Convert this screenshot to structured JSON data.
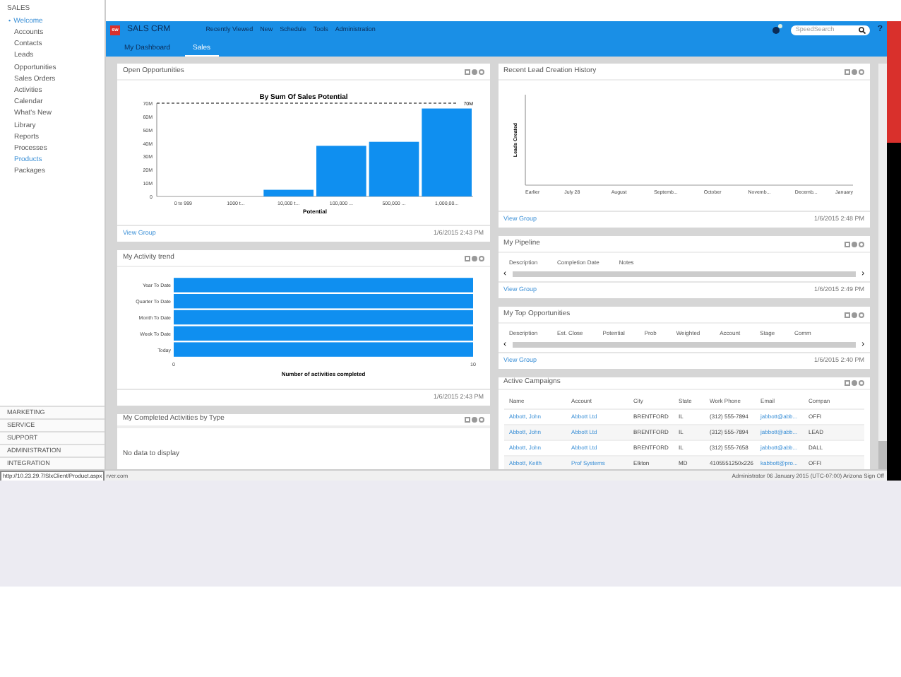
{
  "sidebar": {
    "sections": [
      {
        "label": "SALES",
        "items": [
          {
            "label": "Welcome",
            "selected": true,
            "bullet": "•"
          },
          {
            "label": "Accounts",
            "selected": false
          },
          {
            "label": "Contacts",
            "selected": false
          },
          {
            "label": "Leads",
            "selected": false
          },
          {
            "label": "Opportunities",
            "selected": false
          },
          {
            "label": "Sales Orders",
            "selected": false
          },
          {
            "label": "Activities",
            "selected": false
          },
          {
            "label": "Calendar",
            "selected": false
          },
          {
            "label": "What's New",
            "selected": false
          },
          {
            "label": "Library",
            "selected": false
          },
          {
            "label": "Reports",
            "selected": false
          },
          {
            "label": "Processes",
            "selected": false
          },
          {
            "label": "Products",
            "selected": true
          },
          {
            "label": "Packages",
            "selected": false
          }
        ]
      }
    ],
    "bottom": [
      "MARKETING",
      "SERVICE",
      "SUPPORT",
      "ADMINISTRATION",
      "INTEGRATION"
    ]
  },
  "header": {
    "logo": "sw",
    "app_name": "SALS CRM",
    "menu": [
      "Recently Viewed",
      "New",
      "Schedule",
      "Tools",
      "Administration"
    ],
    "search": {
      "placeholder": "SpeedSearch"
    },
    "help": "?"
  },
  "tabs": [
    {
      "label": "My Dashboard",
      "selected": false
    },
    {
      "label": "Sales",
      "selected": true
    }
  ],
  "left_panels": [
    {
      "title": "Open Opportunities",
      "kind": "chart",
      "footer_link": "View Group",
      "footer_time": "1/6/2015 2:43 PM",
      "chart_data": {
        "type": "bar",
        "orientation": "vertical",
        "title": "By Sum Of Sales Potential",
        "xlabel": "Potential",
        "categories": [
          "0 to 999",
          "1000 t...",
          "10,000 t...",
          "100,000 ...",
          "500,000 ...",
          "1,000,00..."
        ],
        "series": [
          {
            "color": "#0f8ff0",
            "values": [
              0,
              0,
              5,
              38,
              41,
              66
            ]
          }
        ],
        "ylim": [
          0,
          70
        ],
        "yticks": [
          {
            "value": 0,
            "label": "0"
          },
          {
            "value": 10,
            "label": "10M"
          },
          {
            "value": 20,
            "label": "20M"
          },
          {
            "value": 30,
            "label": "30M"
          },
          {
            "value": 40,
            "label": "40M"
          },
          {
            "value": 50,
            "label": "50M"
          },
          {
            "value": 60,
            "label": "60M"
          },
          {
            "value": 70,
            "label": "70M"
          }
        ],
        "annotations": [
          "70M"
        ]
      }
    },
    {
      "title": "My Activity trend",
      "kind": "chart",
      "footer_time": "1/6/2015 2:43 PM",
      "chart_data": {
        "type": "bar",
        "orientation": "horizontal",
        "xlabel": "Number of activities completed",
        "categories": [
          "Year To Date",
          "Quarter To Date",
          "Month To Date",
          "Week To Date",
          "Today"
        ],
        "series": [
          {
            "color": "#0f8ff0",
            "values": [
              10,
              10,
              10,
              10,
              10
            ]
          }
        ],
        "xlim": [
          0,
          10
        ],
        "xticks": [
          0,
          10
        ]
      }
    },
    {
      "title": "My Completed Activities by Type",
      "kind": "message",
      "message": "No data to display"
    }
  ],
  "right_panels": [
    {
      "title": "Recent Lead Creation History",
      "kind": "empty_chart",
      "footer_link": "View Group",
      "footer_time": "1/6/2015 2:48 PM",
      "y_label": "Leads Created",
      "x_labels": [
        "Earlier",
        "July 28",
        "August",
        "Septemb...",
        "October",
        "Novemb...",
        "Decemb...",
        "January"
      ]
    },
    {
      "title": "My Pipeline",
      "kind": "table",
      "columns": [
        "Description",
        "Completion Date",
        "Notes"
      ],
      "scroll_left": "‹",
      "scroll_right": "›",
      "footer_link": "View Group",
      "footer_time": "1/6/2015 2:49 PM"
    },
    {
      "title": "My Top Opportunities",
      "kind": "table",
      "columns": [
        "Description",
        "Est. Close",
        "Potential",
        "Prob",
        "Weighted",
        "Account",
        "Stage",
        "Comm"
      ],
      "scroll_left": "‹",
      "scroll_right": "›",
      "footer_link": "View Group",
      "footer_time": "1/6/2015 2:40 PM"
    },
    {
      "title": "Active Campaigns",
      "kind": "rows",
      "columns": [
        "Name",
        "Account",
        "City",
        "State",
        "Work Phone",
        "Email",
        "Compan"
      ],
      "rows": [
        [
          "Abbott, John",
          "Abbott Ltd",
          "BRENTFORD",
          "IL",
          "(312) 555-7894",
          "jabbott@abb...",
          "OFFI"
        ],
        [
          "Abbott, John",
          "Abbott Ltd",
          "BRENTFORD",
          "IL",
          "(312) 555-7894",
          "jabbott@abb...",
          "LEAD"
        ],
        [
          "Abbott, John",
          "Abbott Ltd",
          "BRENTFORD",
          "IL",
          "(312) 555-7658",
          "jabbott@abb...",
          "DALL"
        ],
        [
          "Abbott, Keith",
          "Prof Systems",
          "Elkton",
          "MD",
          "4105551250x226",
          "kabbott@pro...",
          "OFFI"
        ]
      ]
    }
  ],
  "status_bar": {
    "url": "http://10.23.29.7/SlxClient/Product.aspx",
    "left": "rver.com",
    "right": "Administrator 06 January 2015 (UTC-07:00) Arizona Sign Off"
  }
}
